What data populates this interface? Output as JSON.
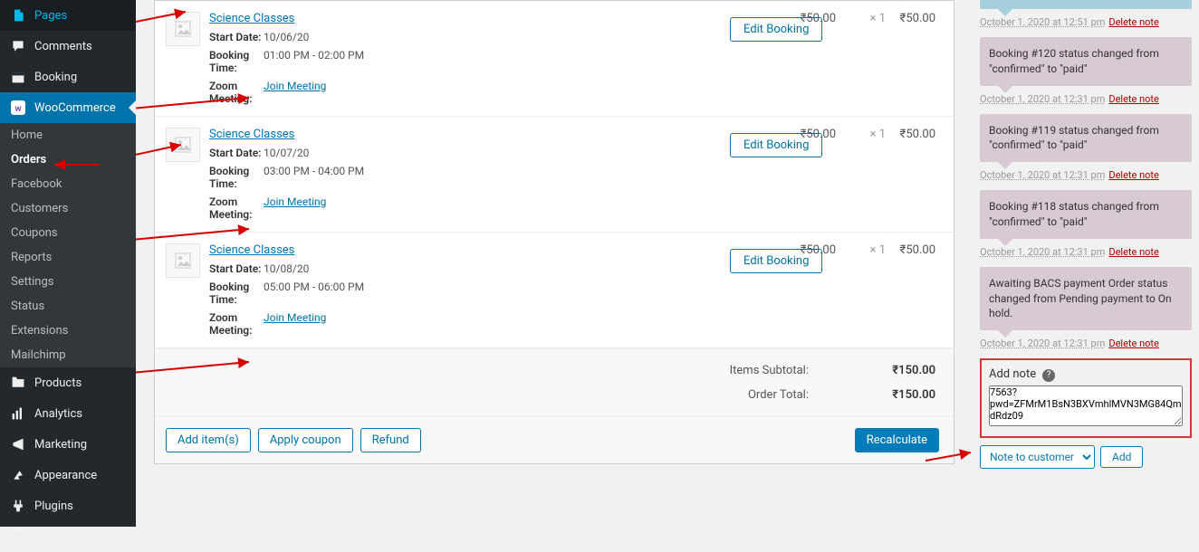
{
  "sidebar": {
    "top_items": [
      {
        "label": "Pages",
        "icon": "pages"
      },
      {
        "label": "Comments",
        "icon": "comments"
      },
      {
        "label": "Booking",
        "icon": "booking"
      }
    ],
    "current": "WooCommerce",
    "submenu": [
      "Home",
      "Orders",
      "Facebook",
      "Customers",
      "Coupons",
      "Reports",
      "Settings",
      "Status",
      "Extensions",
      "Mailchimp"
    ],
    "submenu_active": "Orders",
    "bottom_items": [
      {
        "label": "Products",
        "icon": "products"
      },
      {
        "label": "Analytics",
        "icon": "analytics"
      },
      {
        "label": "Marketing",
        "icon": "marketing"
      },
      {
        "label": "Appearance",
        "icon": "appearance"
      },
      {
        "label": "Plugins",
        "icon": "plugins"
      },
      {
        "label": "Users",
        "icon": "users"
      }
    ]
  },
  "order_items": [
    {
      "name": "Science Classes",
      "start_date": "10/06/20",
      "booking_time": "01:00 PM - 02:00 PM",
      "zoom_link": "Join Meeting",
      "edit_label": "Edit Booking",
      "cost": "₹50.00",
      "qty": "× 1",
      "total": "₹50.00"
    },
    {
      "name": "Science Classes",
      "start_date": "10/07/20",
      "booking_time": "03:00 PM - 04:00 PM",
      "zoom_link": "Join Meeting",
      "edit_label": "Edit Booking",
      "cost": "₹50.00",
      "qty": "× 1",
      "total": "₹50.00"
    },
    {
      "name": "Science Classes",
      "start_date": "10/08/20",
      "booking_time": "05:00 PM - 06:00 PM",
      "zoom_link": "Join Meeting",
      "edit_label": "Edit Booking",
      "cost": "₹50.00",
      "qty": "× 1",
      "total": "₹50.00"
    }
  ],
  "meta_labels": {
    "start_date": "Start Date:",
    "booking_time": "Booking Time:",
    "zoom": "Zoom Meeting:"
  },
  "totals": {
    "items_subtotal_label": "Items Subtotal:",
    "items_subtotal": "₹150.00",
    "order_total_label": "Order Total:",
    "order_total": "₹150.00"
  },
  "actions": {
    "add_items": "Add item(s)",
    "apply_coupon": "Apply coupon",
    "refund": "Refund",
    "recalculate": "Recalculate"
  },
  "notes": [
    {
      "text": "",
      "type": "customer",
      "ts": "October 1, 2020 at 12:51 pm",
      "delete": "Delete note"
    },
    {
      "text": "Booking #120 status changed from \"confirmed\" to \"paid\"",
      "type": "system",
      "ts": "October 1, 2020 at 12:31 pm",
      "delete": "Delete note"
    },
    {
      "text": "Booking #119 status changed from \"confirmed\" to \"paid\"",
      "type": "system",
      "ts": "October 1, 2020 at 12:31 pm",
      "delete": "Delete note"
    },
    {
      "text": "Booking #118 status changed from \"confirmed\" to \"paid\"",
      "type": "system",
      "ts": "October 1, 2020 at 12:31 pm",
      "delete": "Delete note"
    },
    {
      "text": "Awaiting BACS payment Order status changed from Pending payment to On hold.",
      "type": "system",
      "ts": "October 1, 2020 at 12:31 pm",
      "delete": "Delete note"
    }
  ],
  "add_note": {
    "label": "Add note",
    "textarea_value": "7563?pwd=ZFMrM1BsN3BXVmhlMVN3MG84QmdRdz09",
    "select": "Note to customer",
    "add_button": "Add"
  }
}
